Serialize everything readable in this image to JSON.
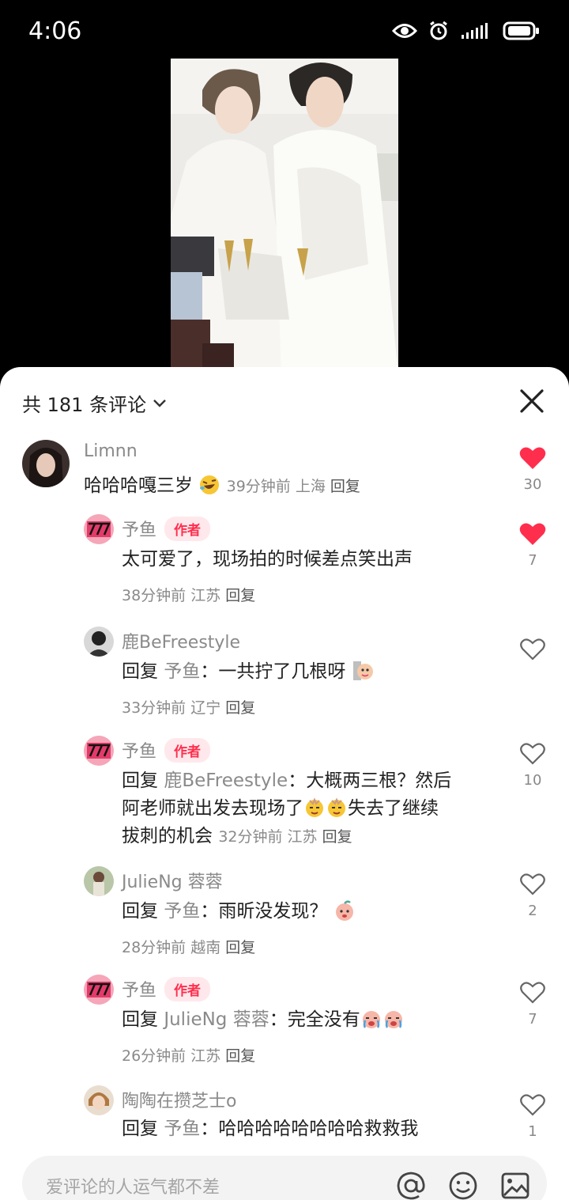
{
  "status": {
    "time": "4:06"
  },
  "header": {
    "count_label": "共 181 条评论"
  },
  "comments": [
    {
      "user": "Limnn",
      "text": "哈哈哈嘎三岁",
      "time": "39分钟前",
      "location": "上海",
      "reply": "回复",
      "likes": "30",
      "liked": true
    },
    {
      "user": "予鱼",
      "badge": "作者",
      "text": "太可爱了，现场拍的时候差点笑出声",
      "time": "38分钟前",
      "location": "江苏",
      "reply": "回复",
      "likes": "7",
      "liked": true
    },
    {
      "user": "鹿BeFreestyle",
      "prefix": "回复",
      "reply_to": "予鱼",
      "text": "：一共拧了几根呀",
      "time": "33分钟前",
      "location": "辽宁",
      "reply": "回复"
    },
    {
      "user": "予鱼",
      "badge": "作者",
      "prefix": "回复",
      "reply_to": "鹿BeFreestyle",
      "text_line1": "：大概两三根？然后",
      "text_line2": "阿老师就出发去现场了",
      "text_line3": "失去了继续",
      "text_line4": "拔刺的机会",
      "time": "32分钟前",
      "location": "江苏",
      "reply": "回复",
      "likes": "10"
    },
    {
      "user": "JulieNg 蓉蓉",
      "prefix": "回复",
      "reply_to": "予鱼",
      "text": "：雨昕没发现？",
      "time": "28分钟前",
      "location": "越南",
      "reply": "回复",
      "likes": "2"
    },
    {
      "user": "予鱼",
      "badge": "作者",
      "prefix": "回复",
      "reply_to": "JulieNg 蓉蓉",
      "text": "：完全没有",
      "time": "26分钟前",
      "location": "江苏",
      "reply": "回复",
      "likes": "7"
    },
    {
      "user": "陶陶在攒芝士o",
      "prefix": "回复",
      "reply_to": "予鱼",
      "text": "：哈哈哈哈哈哈哈哈救救我",
      "likes": "1"
    }
  ],
  "input": {
    "placeholder": "爱评论的人运气都不差"
  },
  "colors": {
    "accent": "#ff2e4d",
    "badge_bg": "#ffe8ec",
    "muted": "#8a8a8a"
  },
  "icons": [
    "eye-icon",
    "alarm-icon",
    "signal-icon",
    "battery-icon",
    "chevron-down-icon",
    "close-icon",
    "heart-icon",
    "at-icon",
    "emoji-icon",
    "image-icon"
  ]
}
